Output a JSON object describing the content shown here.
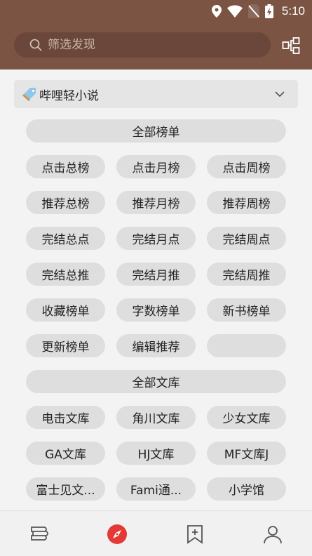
{
  "status_bar": {
    "time": "5:10"
  },
  "search": {
    "placeholder": "筛选发现"
  },
  "source": {
    "label": "哔哩轻小说"
  },
  "sections": [
    {
      "title": "全部榜单",
      "items": [
        "点击总榜",
        "点击月榜",
        "点击周榜",
        "推荐总榜",
        "推荐月榜",
        "推荐周榜",
        "完结总点",
        "完结月点",
        "完结周点",
        "完结总推",
        "完结月推",
        "完结周推",
        "收藏榜单",
        "字数榜单",
        "新书榜单",
        "更新榜单",
        "编辑推荐",
        ""
      ]
    },
    {
      "title": "全部文库",
      "items": [
        "电击文库",
        "角川文库",
        "少女文库",
        "GA文库",
        "HJ文库",
        "MF文库J",
        "富士见文...",
        "Fami通...",
        "小学馆"
      ]
    }
  ],
  "bottom_nav": {
    "items": [
      {
        "name": "bookshelf",
        "icon": "bookshelf-icon"
      },
      {
        "name": "explore",
        "icon": "compass-icon",
        "active": true
      },
      {
        "name": "rss",
        "icon": "bookmark-add-icon"
      },
      {
        "name": "profile",
        "icon": "user-icon"
      }
    ]
  },
  "colors": {
    "header": "#7b5444",
    "accent": "#e53935",
    "chip": "#dedede",
    "background": "#f3f3f3"
  }
}
